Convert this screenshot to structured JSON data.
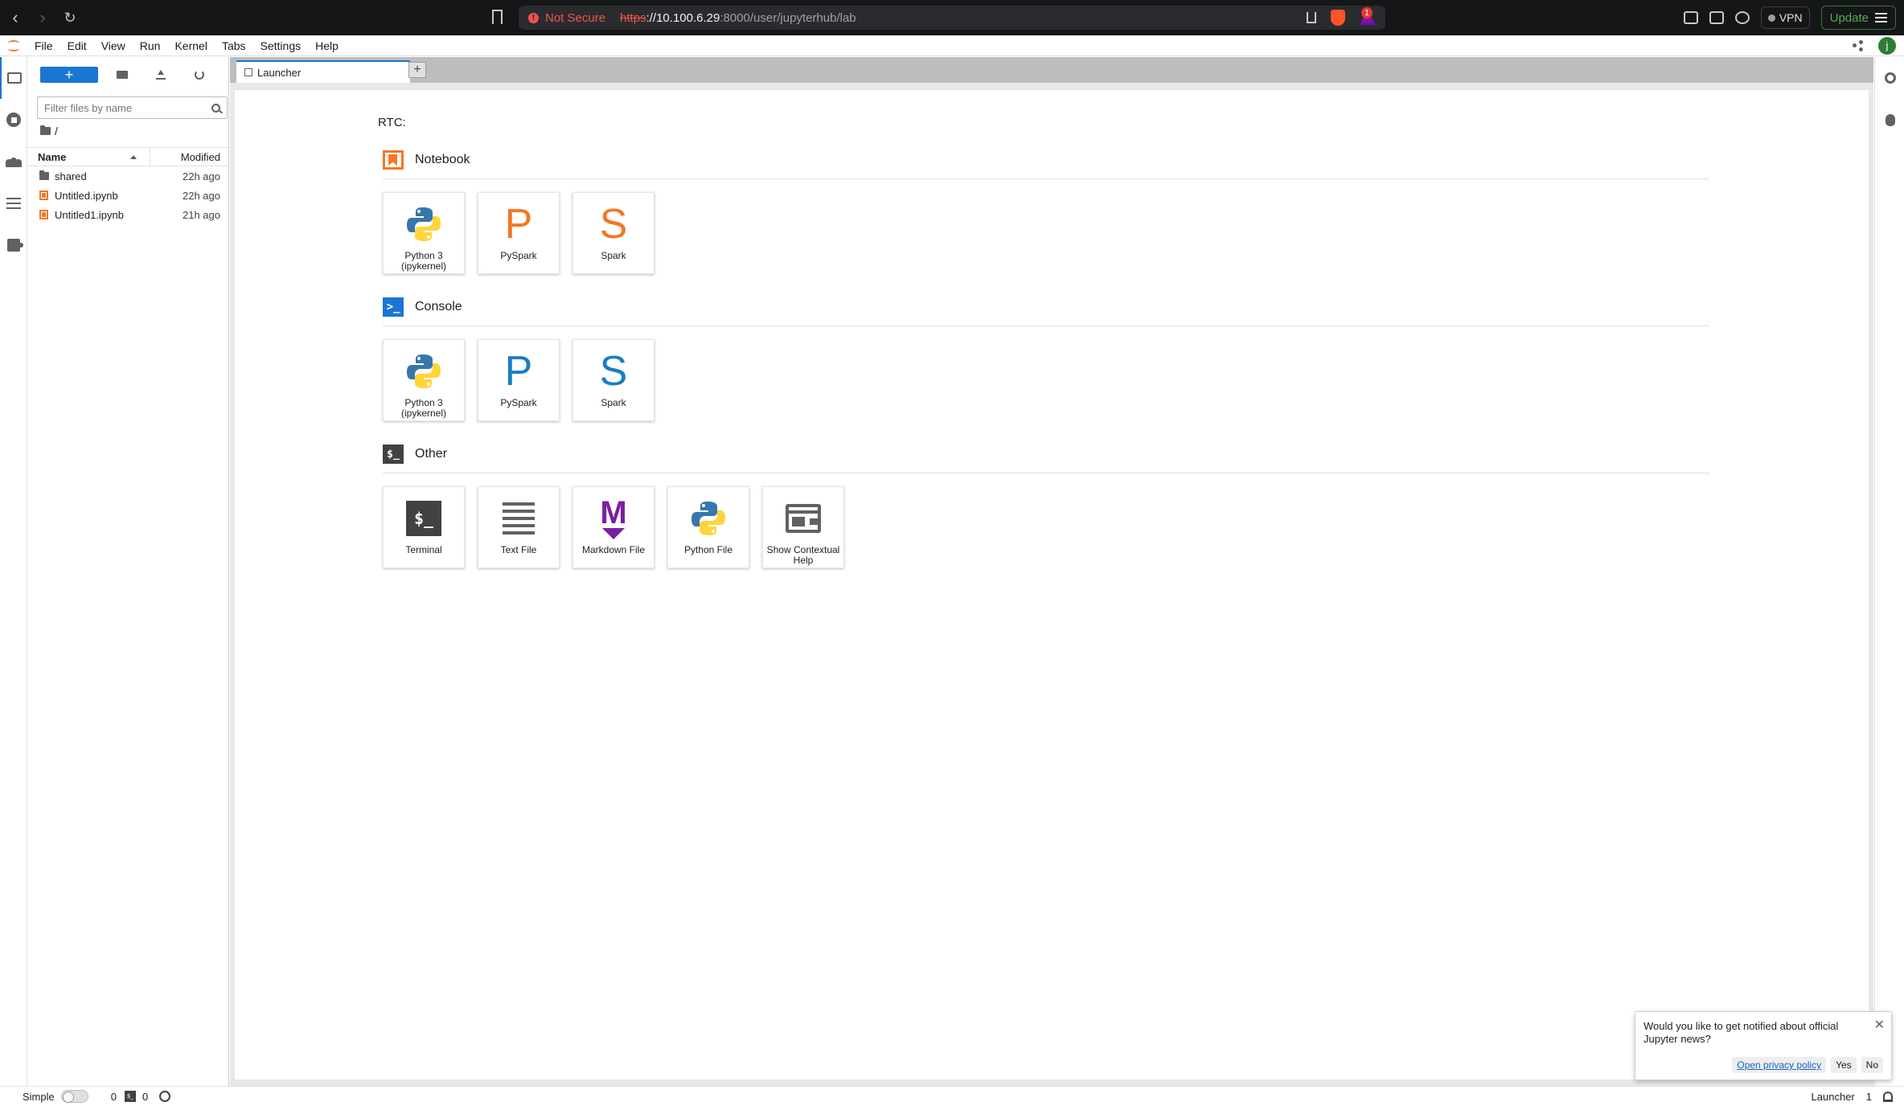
{
  "browser": {
    "security_label": "Not Secure",
    "url_scheme": "https",
    "url_scheme_sep": "://",
    "url_host": "10.100.6.29",
    "url_path": ":8000/user/jupyterhub/lab",
    "vpn_label": "VPN",
    "update_label": "Update",
    "rewards_badge": "1",
    "nav_back_icon": "chevron-left-icon",
    "nav_forward_icon": "chevron-right-icon",
    "reload_icon": "reload-icon"
  },
  "menubar": {
    "items": [
      "File",
      "Edit",
      "View",
      "Run",
      "Kernel",
      "Tabs",
      "Settings",
      "Help"
    ],
    "user_initial": "j"
  },
  "filebrowser": {
    "search_placeholder": "Filter files by name",
    "new_label": "+",
    "breadcrumb": "/",
    "columns": {
      "name": "Name",
      "modified": "Modified"
    },
    "files": [
      {
        "name": "shared",
        "modified": "22h ago",
        "kind": "folder"
      },
      {
        "name": "Untitled.ipynb",
        "modified": "22h ago",
        "kind": "notebook"
      },
      {
        "name": "Untitled1.ipynb",
        "modified": "21h ago",
        "kind": "notebook"
      }
    ]
  },
  "tabs": {
    "active": "Launcher",
    "add_label": "+"
  },
  "launcher": {
    "rtc_label": "RTC:",
    "sections": {
      "notebook": {
        "title": "Notebook",
        "cards": [
          {
            "label": "Python 3 (ipykernel)",
            "icon": "python-logo-icon"
          },
          {
            "label": "PySpark",
            "letter": "P",
            "color": "#f37726"
          },
          {
            "label": "Spark",
            "letter": "S",
            "color": "#f37726"
          }
        ]
      },
      "console": {
        "title": "Console",
        "icon_text": ">_",
        "cards": [
          {
            "label": "Python 3 (ipykernel)",
            "icon": "python-logo-icon"
          },
          {
            "label": "PySpark",
            "letter": "P",
            "color": "#1a7dc4"
          },
          {
            "label": "Spark",
            "letter": "S",
            "color": "#1a7dc4"
          }
        ]
      },
      "other": {
        "title": "Other",
        "icon_text": "$_",
        "cards": [
          {
            "label": "Terminal",
            "icon_text": "$_"
          },
          {
            "label": "Text File",
            "icon": "text-lines-icon"
          },
          {
            "label": "Markdown File",
            "icon_text": "M"
          },
          {
            "label": "Python File",
            "icon": "python-logo-icon"
          },
          {
            "label": "Show Contextual Help",
            "icon": "contextual-help-icon"
          }
        ]
      }
    }
  },
  "notification": {
    "message": "Would you like to get notified about official Jupyter news?",
    "link_label": "Open privacy policy",
    "yes_label": "Yes",
    "no_label": "No",
    "close_label": "✕"
  },
  "statusbar": {
    "mode_label": "Simple",
    "kernels_count": "0",
    "terminal_icon_text": "$_",
    "terminals_count": "0",
    "active_label": "Launcher",
    "notifications_count": "1"
  },
  "colors": {
    "accent": "#1976d2",
    "jupyter_orange": "#f37726",
    "console_blue": "#1a7dc4",
    "markdown_purple": "#7b1fa2"
  }
}
